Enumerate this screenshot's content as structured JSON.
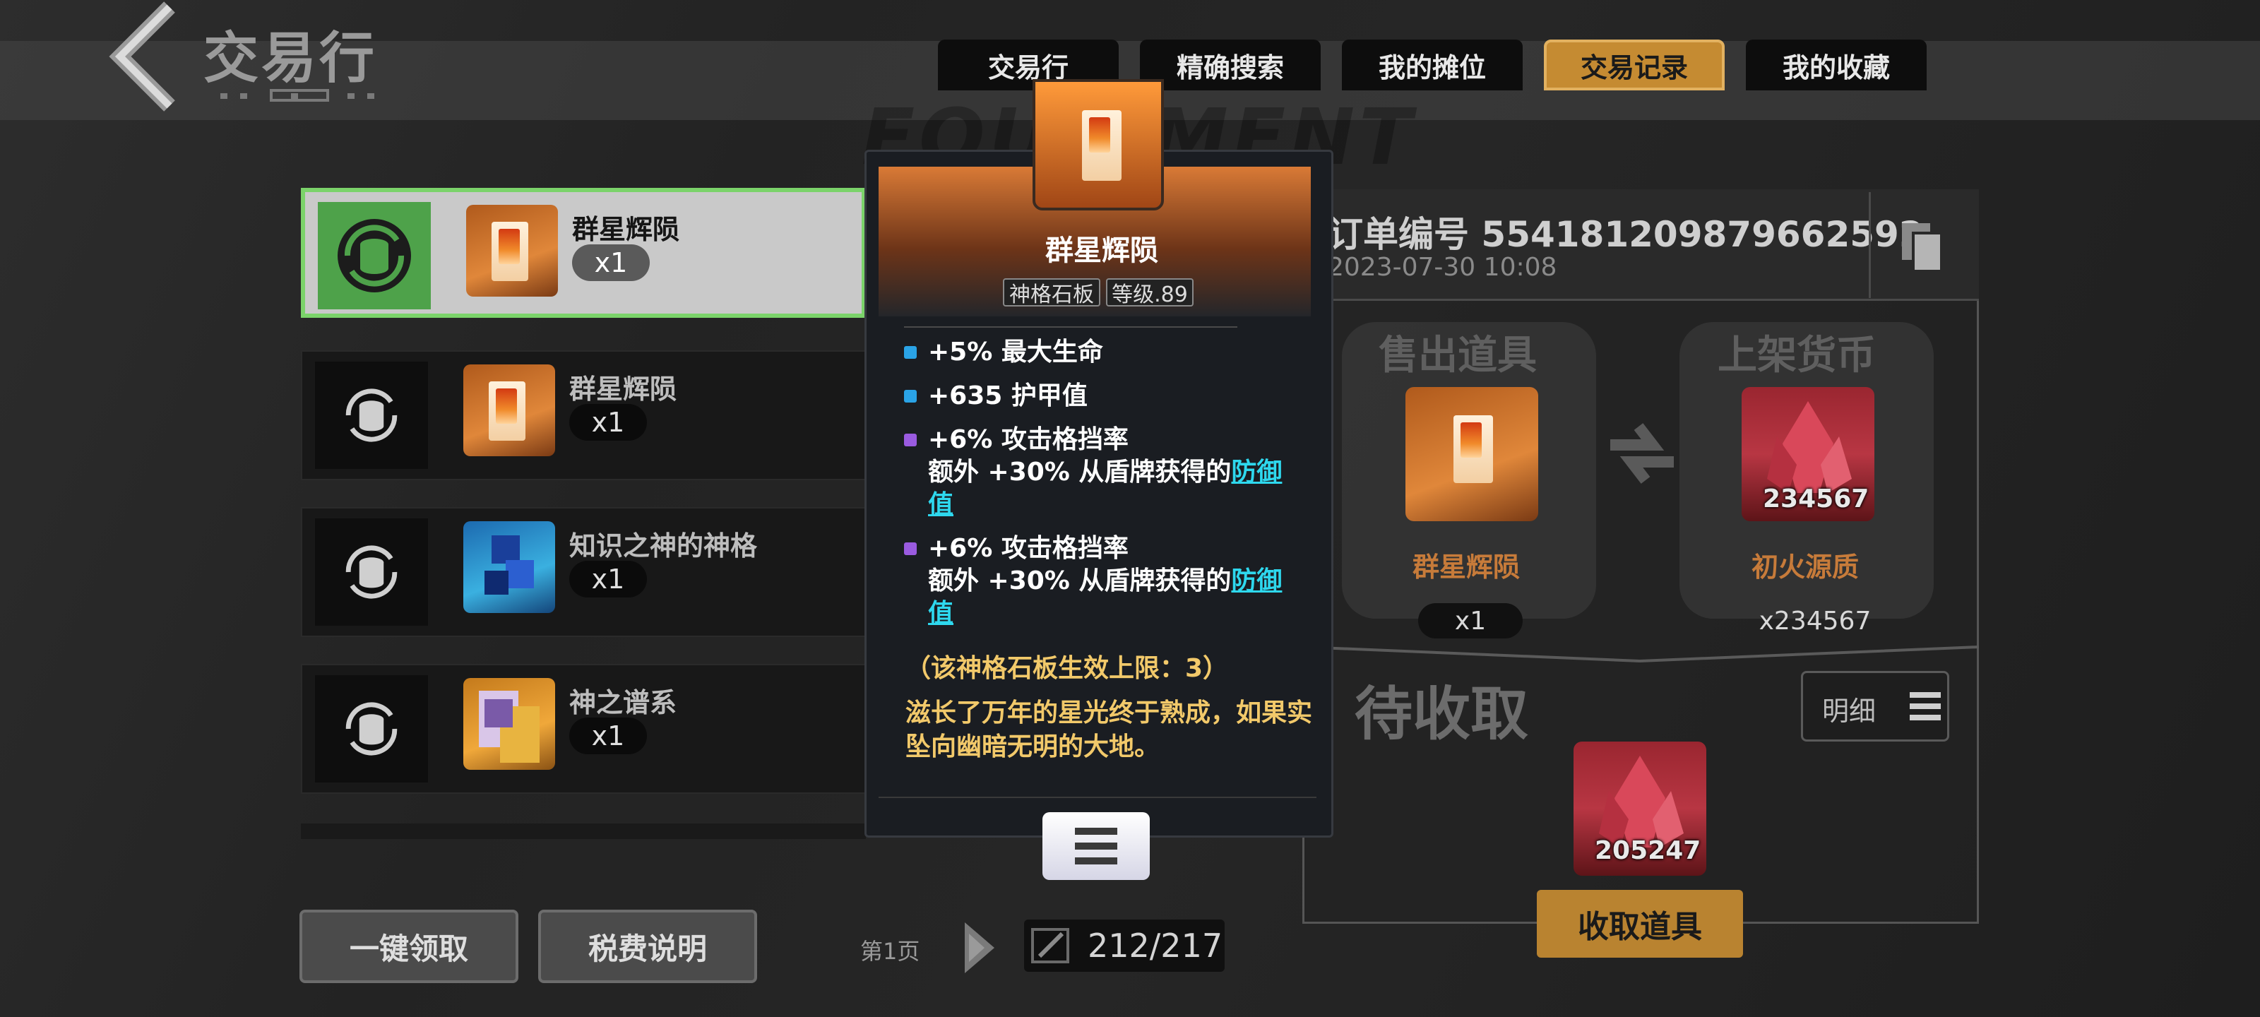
{
  "header": {
    "title": "交易行",
    "tabs": [
      {
        "label": "交易行",
        "active": false
      },
      {
        "label": "精确搜索",
        "active": false
      },
      {
        "label": "我的摊位",
        "active": false
      },
      {
        "label": "交易记录",
        "active": true
      },
      {
        "label": "我的收藏",
        "active": false
      }
    ],
    "watermark": "EQUIPMENT"
  },
  "list": {
    "items": [
      {
        "name": "群星辉陨",
        "qty": "x1",
        "thumb": "orange",
        "selected": true
      },
      {
        "name": "群星辉陨",
        "qty": "x1",
        "thumb": "orange",
        "selected": false
      },
      {
        "name": "知识之神的神格",
        "qty": "x1",
        "thumb": "blue",
        "selected": false
      },
      {
        "name": "神之谱系",
        "qty": "x1",
        "thumb": "gold",
        "selected": false
      }
    ]
  },
  "footer": {
    "claim_all_label": "一键领取",
    "tax_info_label": "税费说明",
    "page_label": "第1页",
    "page_count": "212/217"
  },
  "tooltip": {
    "name": "群星辉陨",
    "tag_type": "神格石板",
    "tag_level": "等级.89",
    "stats": [
      {
        "text": "+5% 最大生命",
        "color": "#2aa3e6"
      },
      {
        "text": "+635 护甲值",
        "color": "#2aa3e6"
      },
      {
        "line1": "+6% 攻击格挡率",
        "line2": "额外 +30% 从盾牌获得的",
        "link": "防御",
        "line3": "值",
        "color": "#9a5be0"
      },
      {
        "line1": "+6% 攻击格挡率",
        "line2": "额外 +30% 从盾牌获得的",
        "link": "防御",
        "line3": "值",
        "color": "#9a5be0"
      }
    ],
    "limit_note": "（该神格石板生效上限：3）",
    "lore": "滋长了万年的星光终于熟成，如果实坠向幽暗无明的大地。"
  },
  "order": {
    "number": "订单编号 554181209879662592",
    "date": "2023-07-30 10:08",
    "sold_title": "售出道具",
    "sold_name": "群星辉陨",
    "sold_qty": "x1",
    "currency_title": "上架货币",
    "currency_name": "初火源质",
    "currency_amount": "234567",
    "currency_qty": "x234567",
    "pending_title": "待收取",
    "detail_label": "明细",
    "pending_amount": "205247",
    "claim_label": "收取道具"
  },
  "colors": {
    "accent": "#c58b32",
    "selected_green": "#4ea24a",
    "link": "#2ed8ee",
    "lore_gold": "#f2c96a"
  }
}
